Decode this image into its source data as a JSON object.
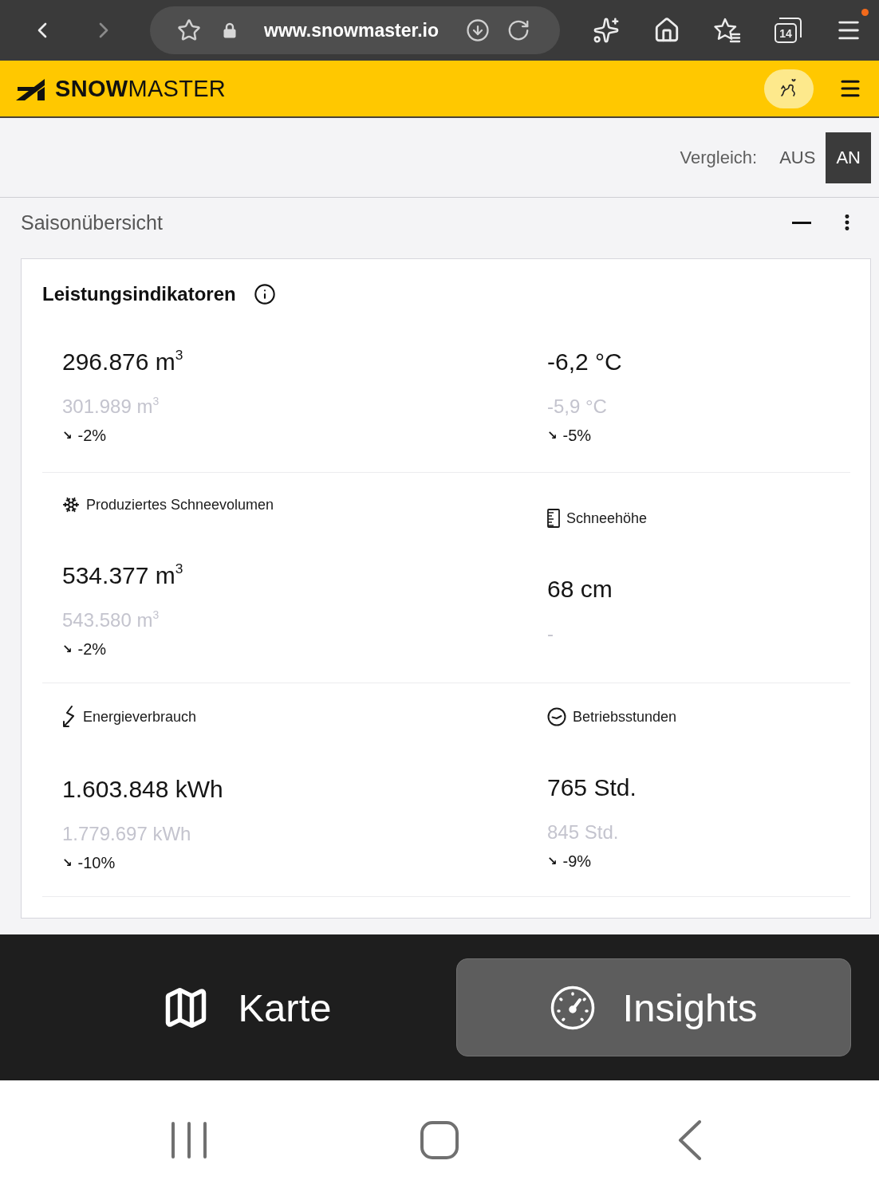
{
  "browser": {
    "nav_buttons": [
      {
        "kind": "back",
        "disabled": false
      },
      {
        "kind": "forward",
        "disabled": true
      }
    ],
    "url": "www.snowmaster.io",
    "tab_count": "14",
    "menu_notification": true
  },
  "header": {
    "brand_bold": "SNOW",
    "brand_regular": "MASTER"
  },
  "comparison": {
    "label": "Vergleich:",
    "options": [
      {
        "label": "AUS",
        "selected": false
      },
      {
        "label": "AN",
        "selected": true
      }
    ]
  },
  "section": {
    "title": "Saisonübersicht"
  },
  "card": {
    "title": "Leistungsindikatoren",
    "rows": [
      {
        "cells": [
          {
            "kind": "volume",
            "value": "296.876 m$^{3}$",
            "previous": "301.989 m$^{3}$",
            "trend": "↘",
            "change": "-2%"
          },
          {
            "kind": "temperature",
            "value": "-6,2 °C",
            "previous": "-5,9 °C",
            "trend": "↘",
            "change": "-5%"
          }
        ]
      },
      {
        "cells": [
          {
            "kind": "snow_volume",
            "label": "Produziertes Schneevolumen",
            "value": "534.377 m$^{3}$",
            "previous": "543.580 m$^{3}$",
            "trend": "↘",
            "change": "-2%"
          },
          {
            "kind": "snow_depth",
            "label": "Schneehöhe",
            "value": "68 cm",
            "previous": "-"
          }
        ]
      },
      {
        "cells": [
          {
            "kind": "energy",
            "label": "Energieverbrauch",
            "value": "1.603.848 kWh",
            "previous": "1.779.697 kWh",
            "trend": "↘",
            "change": "-10%"
          },
          {
            "kind": "hours",
            "label": "Betriebsstunden",
            "value": "765 Std.",
            "previous": "845 Std.",
            "trend": "↘",
            "change": "-9%"
          }
        ]
      }
    ]
  },
  "bottom_nav": [
    {
      "kind": "map",
      "label": "Karte",
      "selected": false
    },
    {
      "kind": "gauge",
      "label": "Insights",
      "selected": true
    }
  ]
}
